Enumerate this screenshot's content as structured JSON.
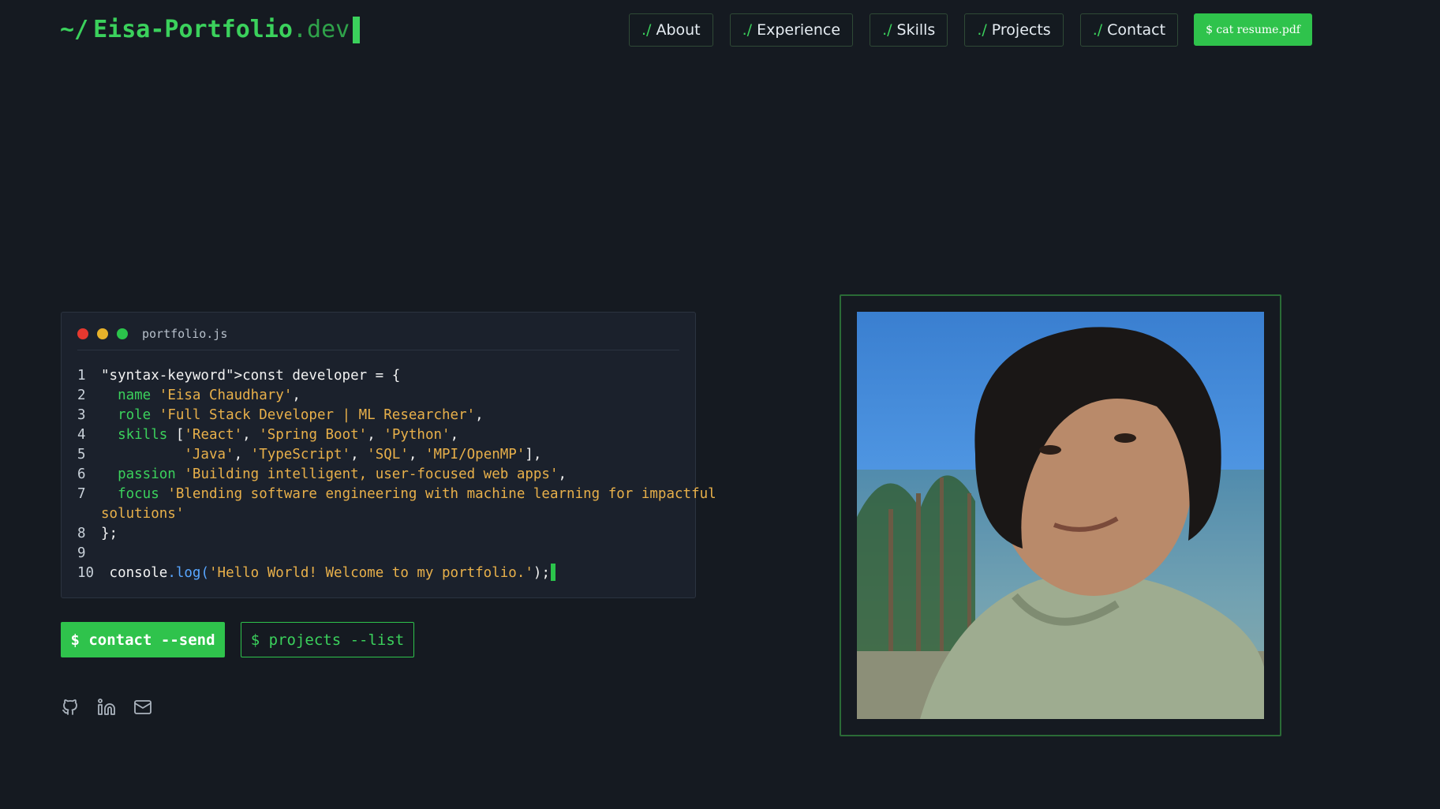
{
  "header": {
    "logo_prefix": "~/",
    "logo_name": "Eisa-Portfolio",
    "logo_ext": ".dev",
    "nav": [
      {
        "prefix": "./",
        "label": "About"
      },
      {
        "prefix": "./",
        "label": "Experience"
      },
      {
        "prefix": "./",
        "label": "Skills"
      },
      {
        "prefix": "./",
        "label": "Projects"
      },
      {
        "prefix": "./",
        "label": "Contact"
      }
    ],
    "resume_label": "$ cat resume.pdf"
  },
  "code_window": {
    "filename": "portfolio.js",
    "lines": {
      "l1": {
        "num": "1",
        "a": "\"syntax-keyword\">const developer = {"
      },
      "l2": {
        "num": "2",
        "key": "name",
        "value": "'Eisa Chaudhary'",
        "tail": ","
      },
      "l3": {
        "num": "3",
        "key": "role",
        "value": "'Full Stack Developer | ML Researcher'",
        "tail": ","
      },
      "l4": {
        "num": "4",
        "key": "skills",
        "open": "[",
        "v1": "'React'",
        "v2": "'Spring Boot'",
        "v3": "'Python'",
        "tail": ","
      },
      "l5": {
        "num": "5",
        "v1": "'Java'",
        "v2": "'TypeScript'",
        "v3": "'SQL'",
        "v4": "'MPI/OpenMP'",
        "tail": "],"
      },
      "l6": {
        "num": "6",
        "key": "passion",
        "value": "'Building intelligent, user-focused web apps'",
        "tail": ","
      },
      "l7": {
        "num": "7",
        "key": "focus",
        "value": "'Blending software engineering with machine learning for impactful",
        "cont": "solutions'"
      },
      "l8": {
        "num": "8",
        "a": "};"
      },
      "l9": {
        "num": "9"
      },
      "l10": {
        "num": "10",
        "obj": "console",
        "fn": ".log(",
        "value": "'Hello World! Welcome to my portfolio.'",
        "tail": ");"
      }
    }
  },
  "cta": {
    "primary_label": "$ contact --send",
    "secondary_label": "$ projects --list"
  },
  "socials": [
    "github-icon",
    "linkedin-icon",
    "mail-icon"
  ],
  "colors": {
    "background": "#151a21",
    "accent": "#2fc34c",
    "string": "#e8b04a",
    "function": "#58a6ff"
  }
}
